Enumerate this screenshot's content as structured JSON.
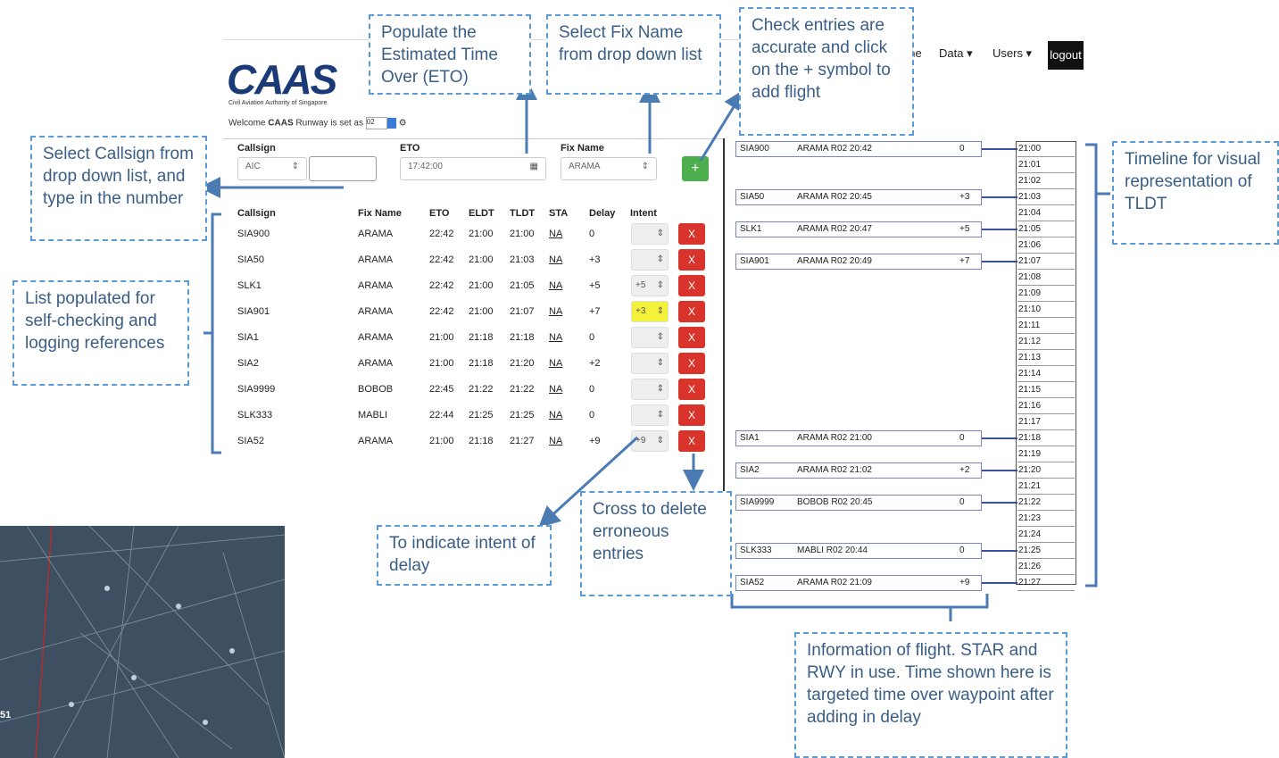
{
  "app": {
    "logo_text": "CAAS",
    "logo_subtext": "Civil Aviation Authority of Singapore",
    "welcome_prefix": "Welcome",
    "welcome_user": "CAAS",
    "welcome_suffix": "Runway is set as",
    "runway_value": "02"
  },
  "nav": {
    "home": "Home",
    "data": "Data ▾",
    "users": "Users ▾",
    "logout": "logout"
  },
  "form": {
    "callsign_label": "Callsign",
    "callsign_prefix": "AIC",
    "eto_label": "ETO",
    "eto_value": "17:42:00",
    "fix_label": "Fix Name",
    "fix_value": "ARAMA",
    "add_symbol": "+"
  },
  "table": {
    "headers": [
      "Callsign",
      "Fix Name",
      "ETO",
      "ELDT",
      "TLDT",
      "STA",
      "Delay",
      "Intent"
    ],
    "rows": [
      {
        "callsign": "SIA900",
        "fix": "ARAMA",
        "eto": "22:42",
        "eldt": "21:00",
        "tldt": "21:00",
        "sta": "NA",
        "delay": "0",
        "intent": ""
      },
      {
        "callsign": "SIA50",
        "fix": "ARAMA",
        "eto": "22:42",
        "eldt": "21:00",
        "tldt": "21:03",
        "sta": "NA",
        "delay": "+3",
        "intent": ""
      },
      {
        "callsign": "SLK1",
        "fix": "ARAMA",
        "eto": "22:42",
        "eldt": "21:00",
        "tldt": "21:05",
        "sta": "NA",
        "delay": "+5",
        "intent": "+5"
      },
      {
        "callsign": "SIA901",
        "fix": "ARAMA",
        "eto": "22:42",
        "eldt": "21:00",
        "tldt": "21:07",
        "sta": "NA",
        "delay": "+7",
        "intent": "+3"
      },
      {
        "callsign": "SIA1",
        "fix": "ARAMA",
        "eto": "21:00",
        "eldt": "21:18",
        "tldt": "21:18",
        "sta": "NA",
        "delay": "0",
        "intent": ""
      },
      {
        "callsign": "SIA2",
        "fix": "ARAMA",
        "eto": "21:00",
        "eldt": "21:18",
        "tldt": "21:20",
        "sta": "NA",
        "delay": "+2",
        "intent": ""
      },
      {
        "callsign": "SIA9999",
        "fix": "BOBOB",
        "eto": "22:45",
        "eldt": "21:22",
        "tldt": "21:22",
        "sta": "NA",
        "delay": "0",
        "intent": ""
      },
      {
        "callsign": "SLK333",
        "fix": "MABLI",
        "eto": "22:44",
        "eldt": "21:25",
        "tldt": "21:25",
        "sta": "NA",
        "delay": "0",
        "intent": ""
      },
      {
        "callsign": "SIA52",
        "fix": "ARAMA",
        "eto": "21:00",
        "eldt": "21:18",
        "tldt": "21:27",
        "sta": "NA",
        "delay": "+9",
        "intent": "+9"
      }
    ],
    "delete_symbol": "X"
  },
  "timeline": {
    "ticks": [
      "21:00",
      "21:01",
      "21:02",
      "21:03",
      "21:04",
      "21:05",
      "21:06",
      "21:07",
      "21:08",
      "21:09",
      "21:10",
      "21:11",
      "21:12",
      "21:13",
      "21:14",
      "21:15",
      "21:16",
      "21:17",
      "21:18",
      "21:19",
      "21:20",
      "21:21",
      "21:22",
      "21:23",
      "21:24",
      "21:25",
      "21:26",
      "21:27"
    ],
    "flights": [
      {
        "callsign": "SIA900",
        "info": "ARAMA R02 20:42",
        "delay": "0"
      },
      {
        "callsign": "SIA50",
        "info": "ARAMA R02 20:45",
        "delay": "+3"
      },
      {
        "callsign": "SLK1",
        "info": "ARAMA R02 20:47",
        "delay": "+5"
      },
      {
        "callsign": "SIA901",
        "info": "ARAMA R02 20:49",
        "delay": "+7"
      },
      {
        "callsign": "SIA1",
        "info": "ARAMA R02 21:00",
        "delay": "0"
      },
      {
        "callsign": "SIA2",
        "info": "ARAMA R02 21:02",
        "delay": "+2"
      },
      {
        "callsign": "SIA9999",
        "info": "BOBOB R02 20:45",
        "delay": "0"
      },
      {
        "callsign": "SLK333",
        "info": "MABLI R02 20:44",
        "delay": "0"
      },
      {
        "callsign": "SIA52",
        "info": "ARAMA R02 21:09",
        "delay": "+9"
      }
    ]
  },
  "callouts": {
    "eto": "Populate the Estimated Time Over (ETO)",
    "fix": "Select Fix Name from drop down list",
    "check": "Check entries are accurate and click on the + symbol to add flight",
    "callsign": "Select Callsign from drop down list, and type in the number",
    "list": "List populated for self-checking and logging references",
    "timeline": "Timeline for visual representation of TLDT",
    "intent": "To indicate intent of delay",
    "cross": "Cross to delete erroneous entries",
    "info": "Information of flight. STAR and RWY in use. Time shown here is targeted time over waypoint after adding in delay"
  },
  "radar": {
    "label": "51"
  },
  "colors": {
    "callout_border": "#5b9bd5",
    "callout_text": "#3a5e86",
    "add_button": "#4cae4c",
    "delete_button": "#d9342b",
    "intent_highlight": "#f4f13a",
    "logo": "#1b3a78"
  }
}
